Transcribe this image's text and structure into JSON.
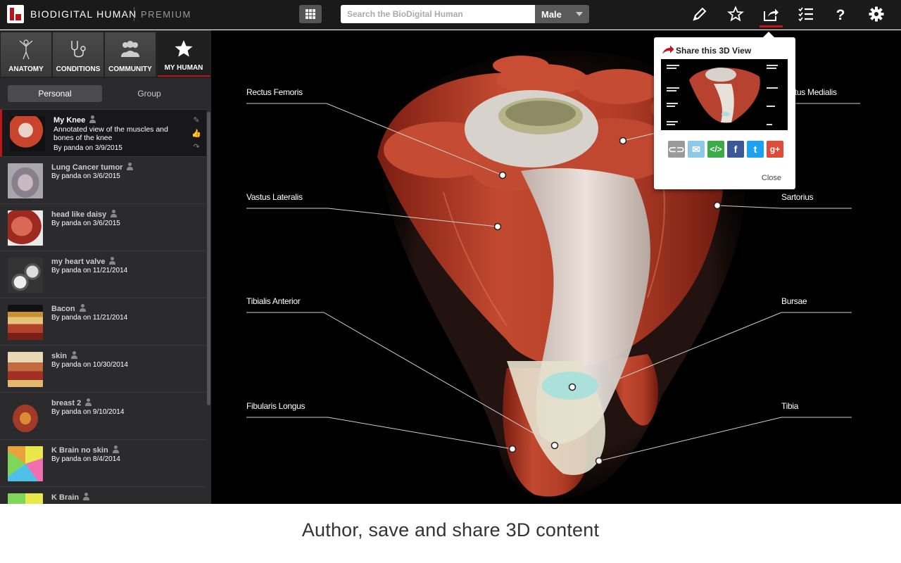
{
  "app": {
    "brand": "BIODIGITAL HUMAN",
    "tier": "PREMIUM"
  },
  "search": {
    "placeholder": "Search the BioDigital Human",
    "value": ""
  },
  "sex_select": {
    "selected": "Male"
  },
  "toolbar": {
    "tools": [
      "pencil-icon",
      "star-icon",
      "share-icon",
      "checklist-icon",
      "help-icon",
      "gear-icon"
    ],
    "active_tool": "share-icon"
  },
  "sidebar": {
    "tabs": [
      {
        "label": "ANATOMY",
        "icon": "anatomy-figure-icon"
      },
      {
        "label": "CONDITIONS",
        "icon": "stethoscope-icon"
      },
      {
        "label": "COMMUNITY",
        "icon": "community-icon"
      },
      {
        "label": "MY HUMAN",
        "icon": "star-icon"
      }
    ],
    "active_tab": "MY HUMAN",
    "subtabs": {
      "personal": "Personal",
      "group": "Group",
      "active": "Personal"
    },
    "items": [
      {
        "title": "My Knee",
        "description": "Annotated view of the muscles and bones of the knee",
        "byline": "By panda on 3/9/2015",
        "selected": true
      },
      {
        "title": "Lung Cancer tumor",
        "description": "",
        "byline": "By panda on 3/6/2015"
      },
      {
        "title": "head like daisy",
        "description": "",
        "byline": "By panda on 3/6/2015"
      },
      {
        "title": "my heart valve",
        "description": "",
        "byline": "By panda on 11/21/2014"
      },
      {
        "title": "Bacon",
        "description": "",
        "byline": "By panda on 11/21/2014"
      },
      {
        "title": "skin",
        "description": "",
        "byline": "By panda on 10/30/2014"
      },
      {
        "title": "breast 2",
        "description": "",
        "byline": "By panda on 9/10/2014"
      },
      {
        "title": "K Brain no skin",
        "description": "",
        "byline": "By panda on 8/4/2014"
      },
      {
        "title": "K Brain",
        "description": "",
        "byline": ""
      }
    ]
  },
  "viewer": {
    "labels": {
      "rectus_femoris": "Rectus Femoris",
      "vastus_medialis": "Vastus Medialis",
      "vastus_lateralis": "Vastus Lateralis",
      "sartorius": "Sartorius",
      "tibialis_anterior": "Tibialis Anterior",
      "bursae": "Bursae",
      "fibularis_longus": "Fibularis Longus",
      "tibia": "Tibia"
    }
  },
  "share_popup": {
    "title": "Share this 3D View",
    "buttons": [
      "link-icon",
      "email-icon",
      "embed-icon",
      "facebook-icon",
      "twitter-icon",
      "google-plus-icon"
    ],
    "close": "Close"
  },
  "caption": "Author, save and share 3D content",
  "colors": {
    "accent": "#c0141b",
    "topbar": "#1a1a1a",
    "sidebar": "#2b2b2e",
    "muscle": "#b84230"
  }
}
